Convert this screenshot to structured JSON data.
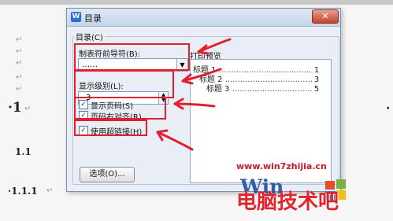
{
  "dialog": {
    "title": "目录",
    "app_icon_label": "W",
    "close_label": "✕",
    "group_label": "目录(C)",
    "leader_label": "制表符前导符(B):",
    "leader_value": "……",
    "levels_label": "显示级别(L):",
    "levels_value": "3",
    "show_page_numbers_label": "显示页码(S)",
    "right_align_label": "页码右对齐(R)",
    "hyperlinks_label": "使用超链接(H)",
    "options_button": "选项(O)...",
    "preview_label": "打印预览"
  },
  "checkboxes": {
    "show_page_numbers": true,
    "right_align": true,
    "hyperlinks": true
  },
  "preview_lines": [
    {
      "text": "标题 1",
      "page": "1"
    },
    {
      "text": "标题 2",
      "page": "3"
    },
    {
      "text": "标题 3",
      "page": "5"
    }
  ],
  "document": {
    "headings": [
      "·1",
      "1.1",
      "·1.1.1"
    ],
    "paragraph_mark": "↵"
  },
  "watermark": {
    "url": "www.win7zhijia.cn",
    "logo_text": "Win",
    "logo_chinese": "电脑技术吧"
  },
  "colors": {
    "annotation_red": "#e0202e",
    "dialog_bg": "#e9eef6",
    "watermark_red": "#c81a2b"
  }
}
